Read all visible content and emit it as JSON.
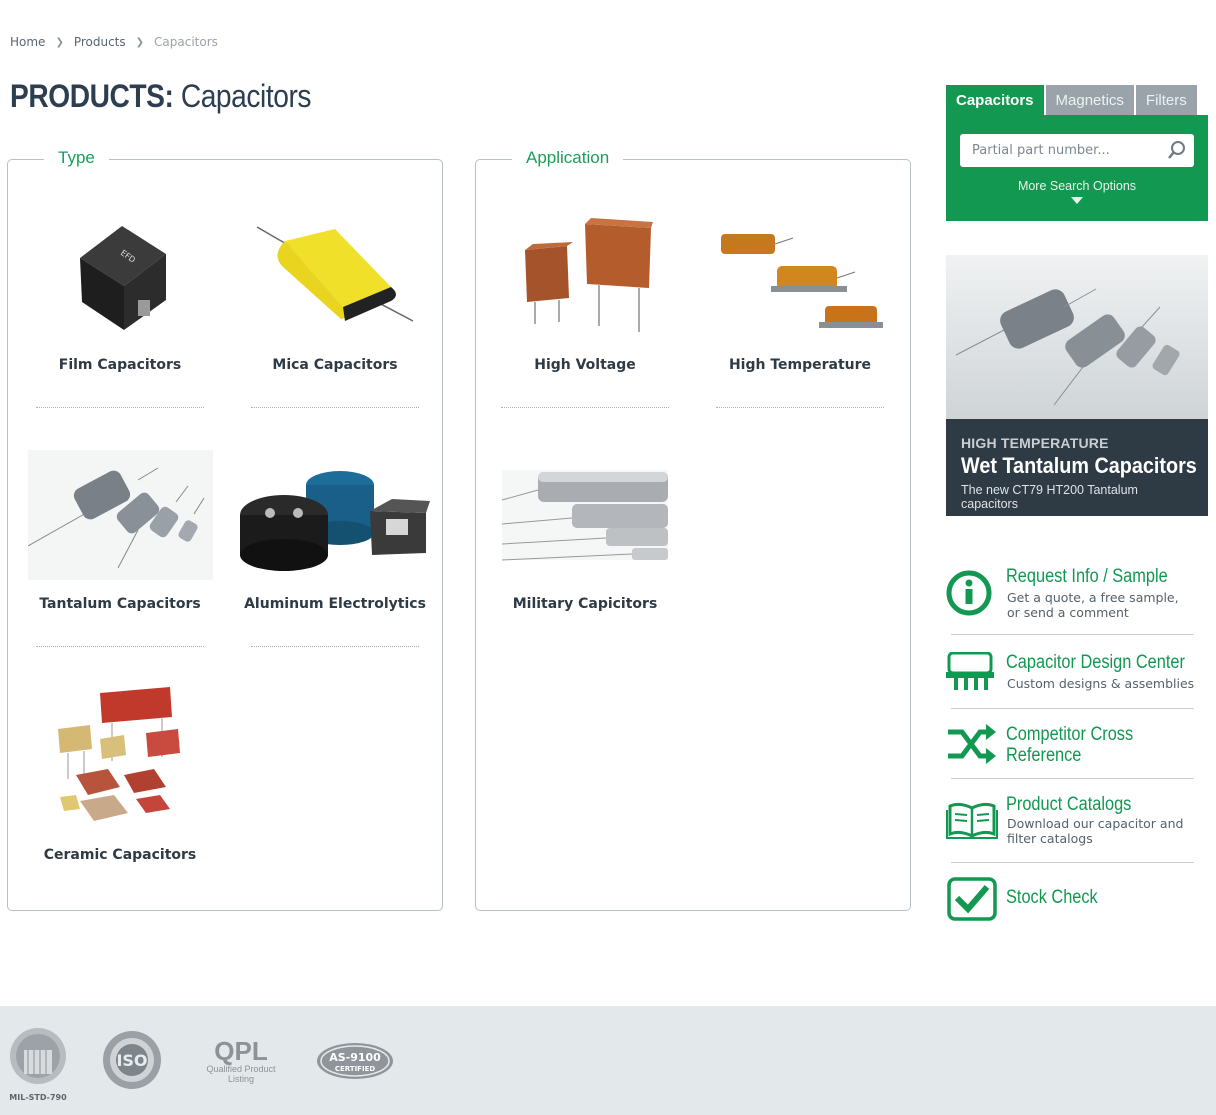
{
  "breadcrumb": {
    "home": "Home",
    "products": "Products",
    "current": "Capacitors"
  },
  "title": {
    "bold": "PRODUCTS:",
    "light": "Capacitors"
  },
  "type_box": {
    "legend": "Type",
    "items": [
      {
        "label": "Film Capacitors"
      },
      {
        "label": "Mica Capacitors"
      },
      {
        "label": "Tantalum Capacitors"
      },
      {
        "label": "Aluminum Electrolytics"
      },
      {
        "label": "Ceramic Capacitors"
      }
    ]
  },
  "application_box": {
    "legend": "Application",
    "items": [
      {
        "label": "High Voltage"
      },
      {
        "label": "High Temperature"
      },
      {
        "label": "Military Capicitors"
      }
    ]
  },
  "search": {
    "tabs": [
      "Capacitors",
      "Magnetics",
      "Filters"
    ],
    "active_tab": "Capacitors",
    "placeholder": "Partial part number...",
    "more_options": "More Search Options"
  },
  "promo": {
    "kicker": "HIGH TEMPERATURE",
    "title": "Wet Tantalum Capacitors",
    "subtitle": "The new CT79 HT200 Tantalum capacitors"
  },
  "links": [
    {
      "title": "Request Info / Sample",
      "desc1": "Get a quote, a free sample,",
      "desc2": "or send a comment",
      "icon": "info-icon"
    },
    {
      "title": "Capacitor Design Center",
      "desc1": "Custom designs & assemblies",
      "desc2": "",
      "icon": "design-center-icon"
    },
    {
      "title": "Competitor Cross",
      "title2": "Reference",
      "icon": "cross-reference-icon"
    },
    {
      "title": "Product Catalogs",
      "desc1": "Download our capacitor and",
      "desc2": "filter catalogs",
      "icon": "book-icon"
    },
    {
      "title": "Stock Check",
      "icon": "checkmark-icon"
    }
  ],
  "footer": {
    "mil_std": "MIL-STD-790",
    "iso": "ISO",
    "qpl": "QPL",
    "qpl_sub1": "Qualified Product",
    "qpl_sub2": "Listing",
    "as9100": "AS-9100",
    "as9100_sub": "CERTIFIED"
  },
  "colors": {
    "brand_green": "#129851",
    "dark": "#2e3a44",
    "tab_grey": "#9aa3a9",
    "footer_bg": "#e3e8eb"
  }
}
